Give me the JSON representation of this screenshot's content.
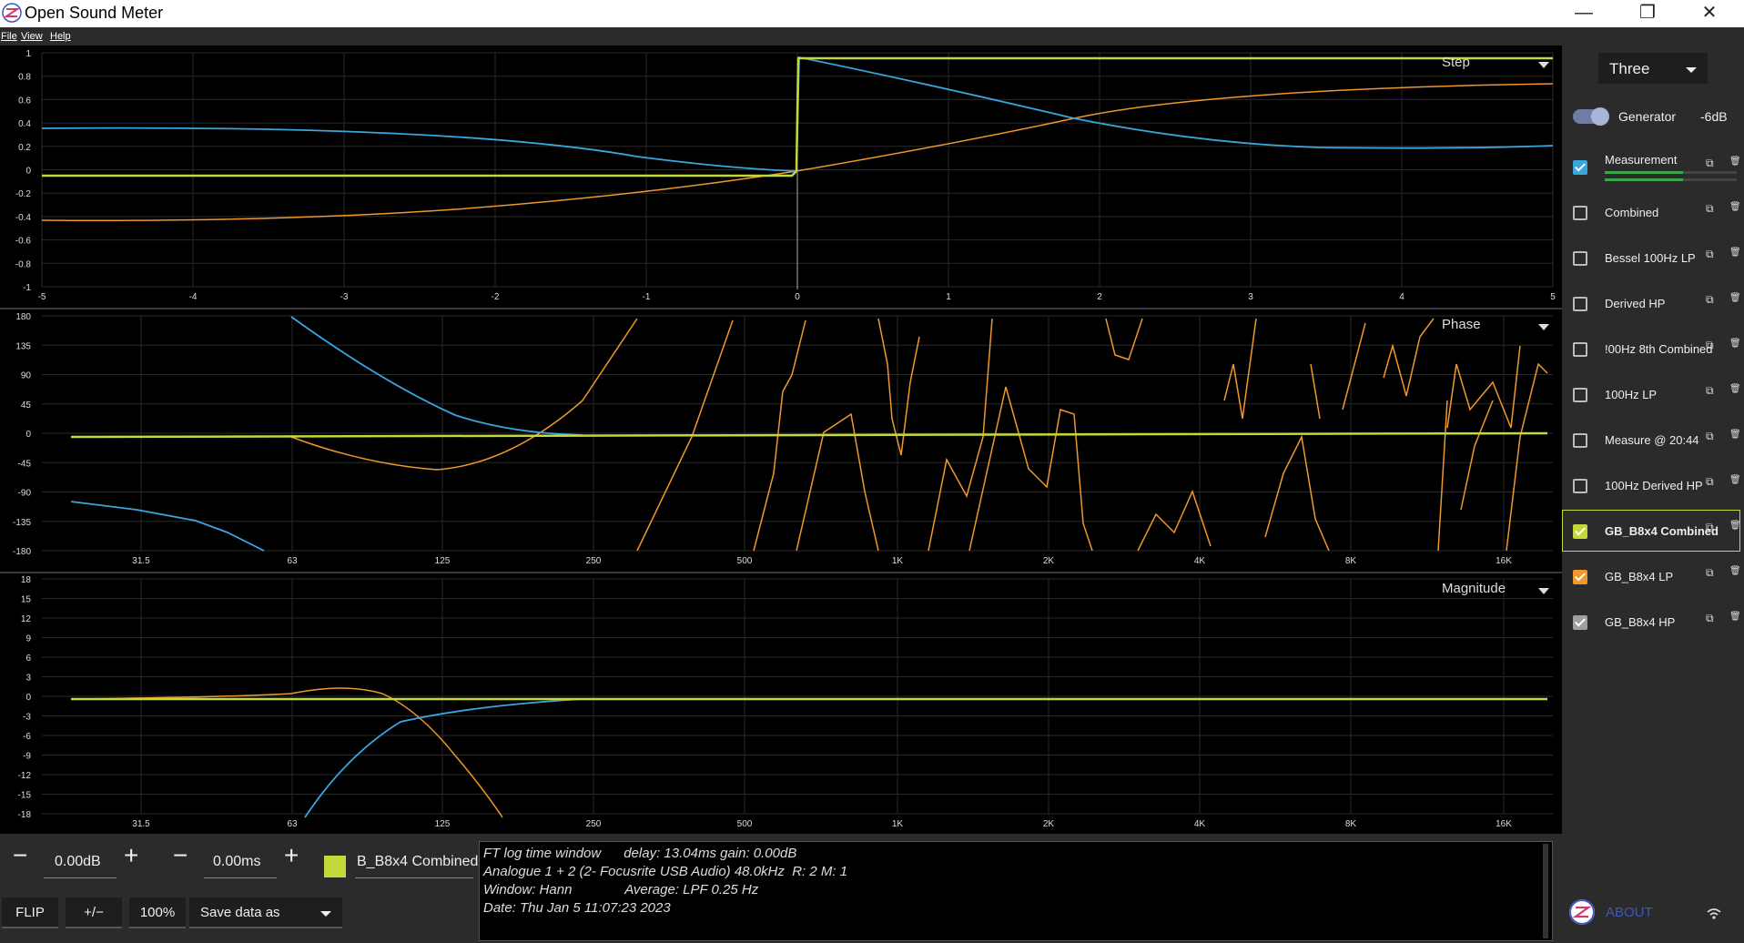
{
  "window": {
    "title": "Open Sound Meter",
    "minimize": "—",
    "maximize": "❐",
    "close": "✕"
  },
  "menu": {
    "file": "File",
    "view": "View",
    "help": "Help"
  },
  "colors": {
    "yellow": "#c5d83a",
    "orange": "#f0982a",
    "blue": "#3aa6e0",
    "grid": "#2a2a2a",
    "panel": "#2b2b2b"
  },
  "plots": {
    "step": {
      "title": "Step",
      "y_ticks": [
        "1",
        "0.8",
        "0.6",
        "0.4",
        "0.2",
        "0",
        "-0.2",
        "-0.4",
        "-0.6",
        "-0.8",
        "-1"
      ],
      "x_ticks": [
        "-5",
        "-4",
        "-3",
        "-2",
        "-1",
        "0",
        "1",
        "2",
        "3",
        "4",
        "5"
      ]
    },
    "phase": {
      "title": "Phase",
      "y_ticks": [
        "180",
        "135",
        "90",
        "45",
        "0",
        "-45",
        "-90",
        "-135",
        "-180"
      ],
      "x_ticks": [
        "31.5",
        "63",
        "125",
        "250",
        "500",
        "1K",
        "2K",
        "4K",
        "8K",
        "16K"
      ]
    },
    "magnitude": {
      "title": "Magnitude",
      "y_ticks": [
        "18",
        "15",
        "12",
        "9",
        "6",
        "3",
        "0",
        "-3",
        "-6",
        "-9",
        "-12",
        "-15",
        "-18"
      ],
      "x_ticks": [
        "31.5",
        "63",
        "125",
        "250",
        "500",
        "1K",
        "2K",
        "4K",
        "8K",
        "16K"
      ]
    }
  },
  "sidebar": {
    "mode": "Three",
    "generator_label": "Generator",
    "generator_level": "-6dB",
    "items": [
      {
        "label": "Measurement",
        "checked": true,
        "color": "#3aa6e0"
      },
      {
        "label": "Combined",
        "checked": false
      },
      {
        "label": "Bessel 100Hz LP",
        "checked": false
      },
      {
        "label": "Derived HP",
        "checked": false
      },
      {
        "label": "!00Hz 8th Combined",
        "checked": false
      },
      {
        "label": "100Hz LP",
        "checked": false
      },
      {
        "label": "Measure @ 20:44",
        "checked": false
      },
      {
        "label": "100Hz Derived HP",
        "checked": false
      },
      {
        "label": "GB_B8x4 Combined",
        "checked": true,
        "color": "#c5d83a",
        "selected": true
      },
      {
        "label": "GB_B8x4 LP",
        "checked": true,
        "color": "#f0982a"
      },
      {
        "label": "GB_B8x4 HP",
        "checked": true,
        "color": "#a0a0a0"
      }
    ],
    "about": "ABOUT"
  },
  "bottom": {
    "minus": "−",
    "plus": "+",
    "gain": "0.00dB",
    "delay": "0.00ms",
    "source_name": "B_B8x4 Combined",
    "flip": "FLIP",
    "polarity": "+/−",
    "scale": "100%",
    "save": "Save data as",
    "info": [
      "FT log time window      delay: 13.04ms gain: 0.00dB",
      "Analogue 1 + 2 (2- Focusrite USB Audio) 48.0kHz  R: 2 M: 1",
      "Window: Hann              Average: LPF 0.25 Hz",
      "Date: Thu Jan 5 11:07:23 2023"
    ]
  }
}
